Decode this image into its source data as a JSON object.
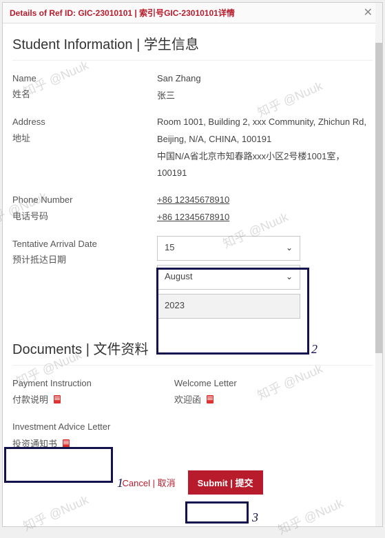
{
  "header": {
    "title": "Details of Ref ID: GIC-23010101 | 索引号GIC-23010101详情"
  },
  "sections": {
    "student_info": "Student Information | 学生信息",
    "documents": "Documents | 文件资料"
  },
  "student": {
    "name_label_en": "Name",
    "name_label_zh": "姓名",
    "name_en": "San Zhang",
    "name_zh": "张三",
    "address_label_en": "Address",
    "address_label_zh": "地址",
    "address_en": "Room 1001, Building 2, xxx Community, Zhichun Rd, Beijing, N/A, CHINA, 100191",
    "address_zh": "中国N/A省北京市知春路xxx小区2号楼1001室，100191",
    "phone_label_en": "Phone Number",
    "phone_label_zh": "电话号码",
    "phone_value": "+86 12345678910",
    "arrival_label_en": "Tentative Arrival Date",
    "arrival_label_zh": "预计抵达日期",
    "arrival_day": "15",
    "arrival_month": "August",
    "arrival_year": "2023"
  },
  "documents": {
    "payment_instruction_en": "Payment Instruction",
    "payment_instruction_zh": "付款说明",
    "welcome_letter_en": "Welcome Letter",
    "welcome_letter_zh": "欢迎函",
    "investment_letter_en": "Investment Advice Letter",
    "investment_letter_zh": "投资通知书"
  },
  "footer": {
    "cancel": "Cancel | 取消",
    "submit": "Submit | 提交"
  },
  "annotations": {
    "n1": "1",
    "n2": "2",
    "n3": "3"
  },
  "watermark": "知乎 @Nuuk"
}
